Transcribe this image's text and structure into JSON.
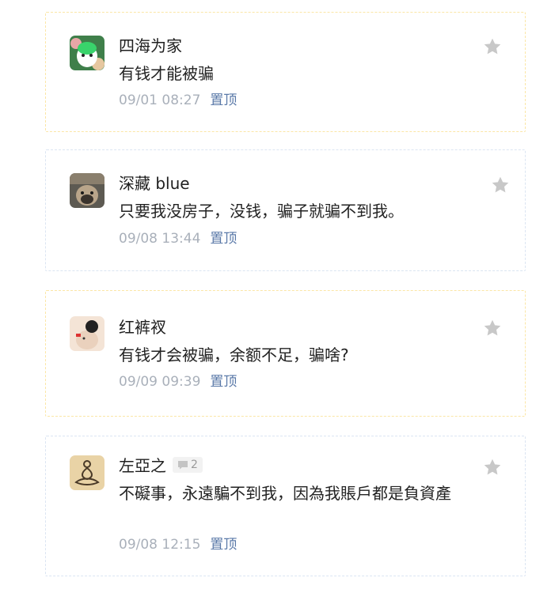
{
  "colors": {
    "card_border_yellow": "#fbe6a6",
    "card_border_blue": "#dbe5f2",
    "pin_link": "#5a79a8",
    "time_text": "#a9b0ba",
    "star": "#c8c8c8"
  },
  "icons": {
    "star": "star-icon",
    "reply": "comment-icon"
  },
  "comments": [
    {
      "user": "四海为家",
      "text": "有钱才能被骗",
      "time": "09/01 08:27",
      "pin_label": "置顶"
    },
    {
      "user": "深藏 blue",
      "text": "只要我没房子，没钱，骗子就骗不到我。",
      "time": "09/08 13:44",
      "pin_label": "置顶"
    },
    {
      "user": "红裤衩",
      "text": "有钱才会被骗，余额不足，骗啥?",
      "time": "09/09 09:39",
      "pin_label": "置顶"
    },
    {
      "user": "左亞之",
      "replies": "2",
      "text": "不礙事，永遠騙不到我，因為我賬戶都是負資產",
      "time": "09/08 12:15",
      "pin_label": "置顶"
    }
  ]
}
